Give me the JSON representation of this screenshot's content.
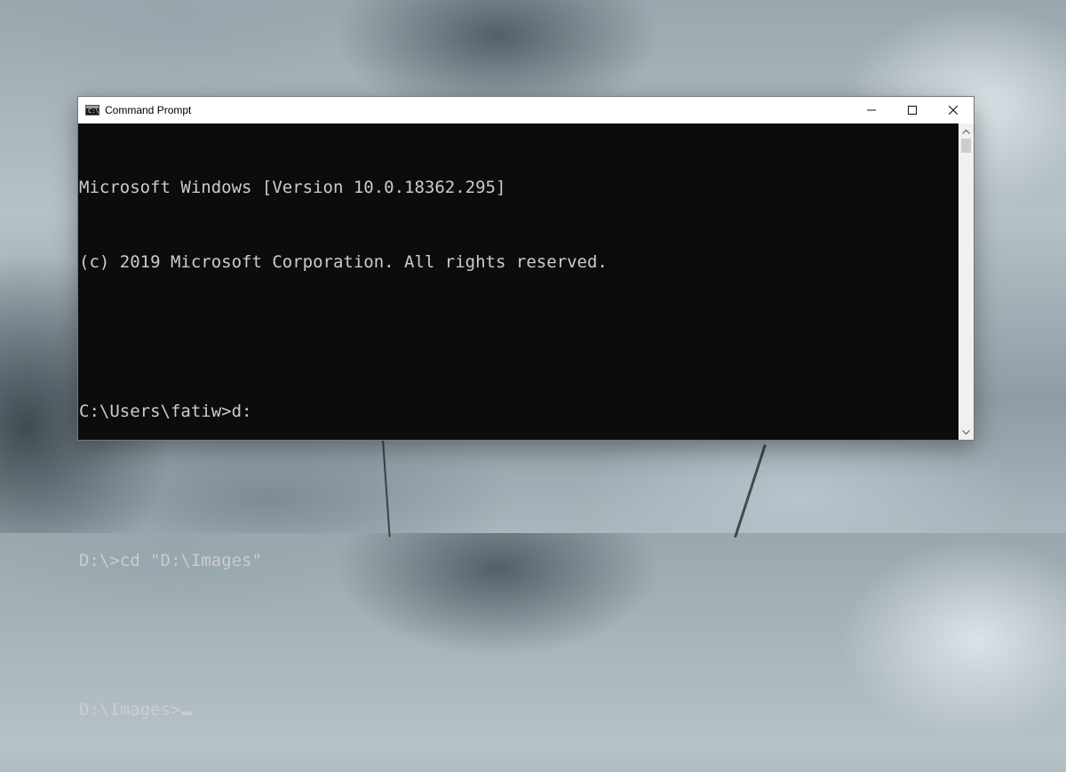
{
  "window": {
    "title": "Command Prompt",
    "icon": "cmd-icon",
    "icon_text": "C:\\_"
  },
  "controls": {
    "minimize": "minimize-icon",
    "maximize": "maximize-icon",
    "close": "close-icon"
  },
  "console": {
    "lines": [
      "Microsoft Windows [Version 10.0.18362.295]",
      "(c) 2019 Microsoft Corporation. All rights reserved.",
      "",
      "C:\\Users\\fatiw>d:",
      "",
      "D:\\>cd \"D:\\Images\"",
      "",
      "D:\\Images>"
    ]
  },
  "colors": {
    "console_bg": "#0c0c0c",
    "console_fg": "#cccccc",
    "titlebar_bg": "#ffffff"
  }
}
